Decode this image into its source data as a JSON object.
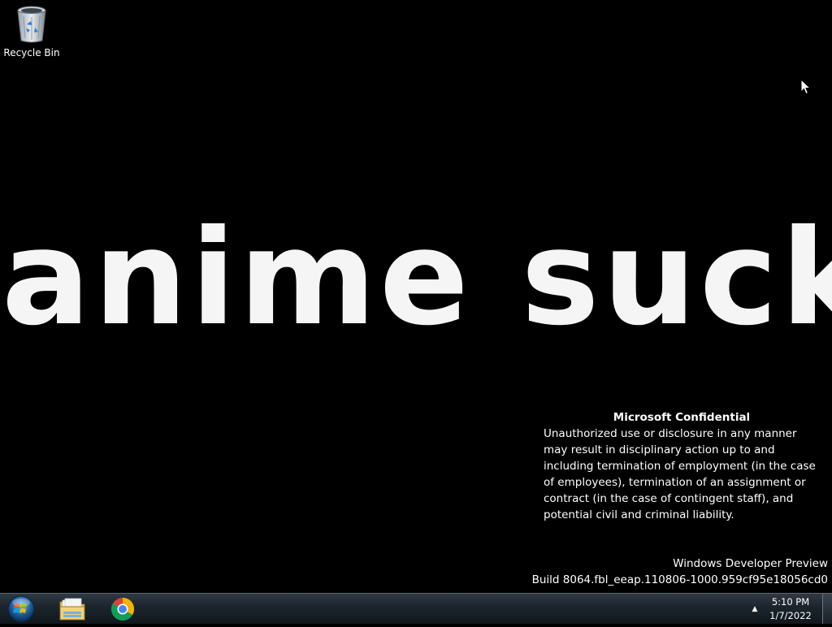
{
  "desktop": {
    "icons": [
      {
        "label": "Recycle Bin",
        "icon": "recycle-bin-icon"
      }
    ],
    "wallpaper_text": "anime sucks",
    "confidential": {
      "title": "Microsoft Confidential",
      "body": "Unauthorized use or disclosure in any manner may result in disciplinary action up to and including termination of employment (in the case of employees), termination of an assignment or contract (in the case of contingent staff), and potential civil and criminal liability."
    },
    "watermark": {
      "line1": "Windows Developer Preview",
      "line2": "Build 8064.fbl_eeap.110806-1000.959cf95e18056cd0"
    }
  },
  "taskbar": {
    "start": {
      "icon": "windows-start-orb-icon"
    },
    "pinned": [
      {
        "name": "File Explorer",
        "icon": "folder-icon"
      },
      {
        "name": "Google Chrome",
        "icon": "chrome-icon"
      }
    ],
    "tray": {
      "show_hidden_icon": "chevron-up-icon",
      "time": "5:10 PM",
      "date": "1/7/2022"
    }
  }
}
